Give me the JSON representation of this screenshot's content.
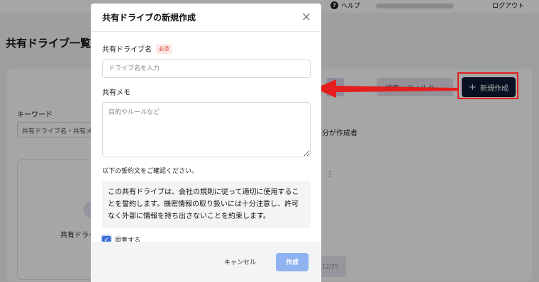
{
  "topbar": {
    "help_label": "ヘルプ",
    "logout_label": "ログアウト"
  },
  "page": {
    "title": "共有ドライブ一覧",
    "keyword_label": "キーワード",
    "keyword_placeholder": "共有ドライブ名・共有メモ",
    "filter_label": "検索・フィルタ",
    "creator_label": "自分が作成者",
    "card_label": "共有ドライブ",
    "card_date": "12/25",
    "new_button": "新規作成",
    "kebab": "⋮"
  },
  "modal": {
    "title": "共有ドライブの新規作成",
    "close_icon": "×",
    "name_label": "共有ドライブ名",
    "required_badge": "必須",
    "name_placeholder": "ドライブ名を入力",
    "memo_label": "共有メモ",
    "memo_placeholder": "目的やルールなど",
    "pledge_intro": "以下の誓約文をご確認ください。",
    "pledge_text": "この共有ドライブは、会社の規則に従って適切に使用することを誓約します。機密情報の取り扱いには十分注意し、許可なく外部に情報を持ち出さないことを約束します。",
    "agree_label": "同意する",
    "agree_checked": true,
    "cancel_label": "キャンセル",
    "create_label": "作成"
  },
  "colors": {
    "annotation_red": "#e41e1e",
    "primary_dark": "#0f1a33",
    "create_button": "#8fb2f0",
    "checkbox": "#3d6fd8"
  }
}
